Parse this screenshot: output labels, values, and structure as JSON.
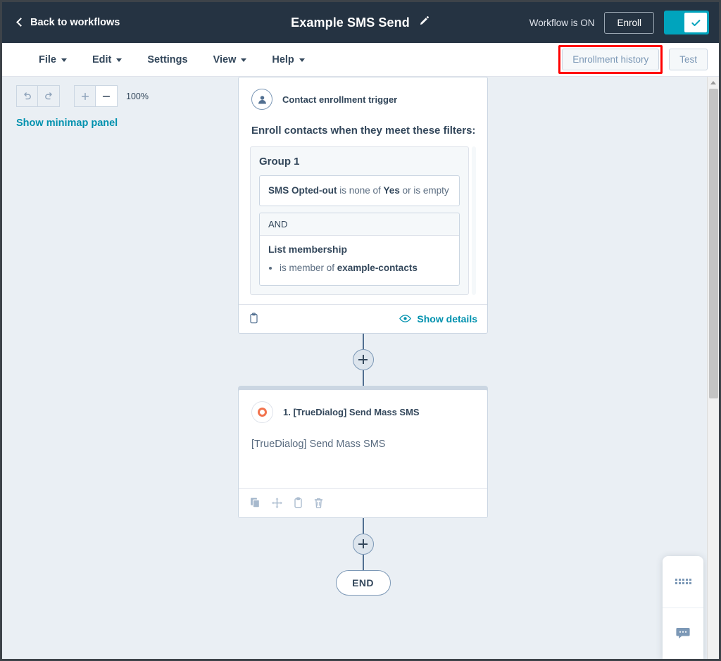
{
  "header": {
    "back_label": "Back to workflows",
    "back_icon": "chevron-left-icon",
    "title": "Example SMS Send",
    "edit_icon": "pencil-icon",
    "status_text": "Workflow is ON",
    "enroll_label": "Enroll",
    "toggle_state": "on",
    "toggle_icon": "check-icon",
    "bg_color": "#253342",
    "toggle_color": "#00a4bd"
  },
  "menubar": {
    "items": [
      {
        "label": "File",
        "has_caret": true
      },
      {
        "label": "Edit",
        "has_caret": true
      },
      {
        "label": "Settings",
        "has_caret": false
      },
      {
        "label": "View",
        "has_caret": true
      },
      {
        "label": "Help",
        "has_caret": true
      }
    ],
    "enrollment_history_label": "Enrollment history",
    "test_label": "Test",
    "highlight_color": "#ff0000"
  },
  "toolbar": {
    "undo_icon": "undo-icon",
    "redo_icon": "redo-icon",
    "zoom_in_label": "+",
    "zoom_out_label": "—",
    "zoom_level": "100%",
    "minimap_link": "Show minimap panel",
    "link_color": "#0091ae"
  },
  "trigger_card": {
    "icon": "contact-avatar-icon",
    "header": "Contact enrollment trigger",
    "filters_title": "Enroll contacts when they meet these filters:",
    "group": {
      "title": "Group 1",
      "filter_prefix": "SMS Opted-out",
      "filter_mid": " is none of ",
      "filter_value": "Yes",
      "filter_suffix": " or is empty",
      "operator": "AND",
      "and_title": "List membership",
      "and_bullet_prefix": "is member of ",
      "and_bullet_value": "example-contacts"
    },
    "footer": {
      "clipboard_icon": "clipboard-icon",
      "show_details_label": "Show details",
      "show_details_icon": "eye-icon"
    }
  },
  "action_card": {
    "logo_icon": "truedialog-logo-icon",
    "title": "1. [TrueDialog] Send Mass SMS",
    "description": "[TrueDialog] Send Mass SMS",
    "footer_icons": [
      "copy-icon",
      "move-icon",
      "clipboard-icon",
      "trash-icon"
    ]
  },
  "flow": {
    "add_step_icon": "plus-icon",
    "end_label": "END"
  },
  "chat_widget": {
    "handle_icon": "drag-dots-icon",
    "chat_icon": "chat-bubble-icon"
  },
  "scrollbar": {
    "up_arrow_icon": "arrow-up-icon"
  }
}
